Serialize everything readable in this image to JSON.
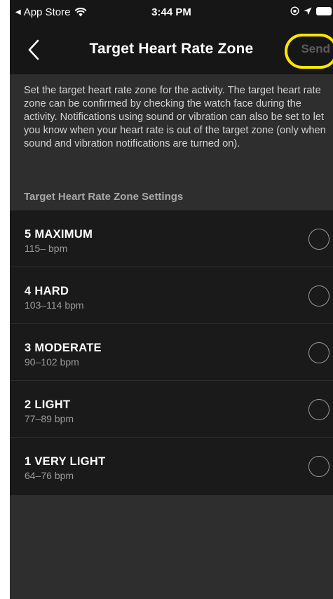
{
  "status_bar": {
    "back_app": "App Store",
    "time": "3:44 PM"
  },
  "nav": {
    "title": "Target Heart Rate Zone",
    "send_label": "Send"
  },
  "description": "Set the target heart rate zone for the activity. The target heart rate zone can be confirmed by checking the watch face during the activity. Notifications using sound or vibration can also be set to let you know when your heart rate is out of the target zone (only when sound and vibration notifications are turned on).",
  "section_header": "Target Heart Rate Zone Settings",
  "zones": [
    {
      "name": "5 MAXIMUM",
      "range": "115– bpm",
      "selected": false
    },
    {
      "name": "4 HARD",
      "range": "103–114 bpm",
      "selected": false
    },
    {
      "name": "3 MODERATE",
      "range": "90–102 bpm",
      "selected": false
    },
    {
      "name": "2 LIGHT",
      "range": "77–89 bpm",
      "selected": false
    },
    {
      "name": "1 VERY LIGHT",
      "range": "64–76 bpm",
      "selected": false
    }
  ],
  "colors": {
    "highlight": "#ffe600",
    "background": "#2e2e2e",
    "list_background": "#1a1a1a"
  }
}
